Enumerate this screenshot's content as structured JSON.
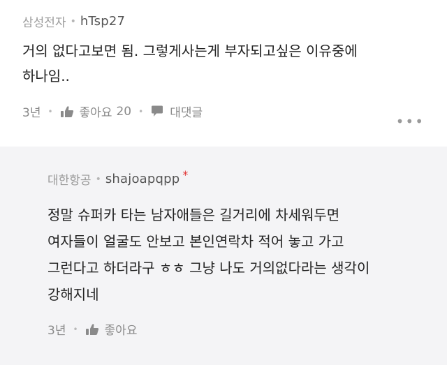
{
  "comments": [
    {
      "company": "삼성전자",
      "nickname": "hTsp27",
      "text_lines": [
        "거의 없다고보면 됨. 그렇게사는게 부자되고싶은 이유중에",
        "하나임.."
      ],
      "time": "3년",
      "like_label": "좋아요",
      "like_count": "20",
      "reply_label": "대댓글",
      "more_label": "•••"
    },
    {
      "company": "대한항공",
      "nickname": "shajoapqpp",
      "star": "*",
      "text_lines": [
        "정말 슈퍼카 타는 남자애들은 길거리에 차세워두면",
        "여자들이 얼굴도 안보고 본인연락차 적어 놓고 가고",
        "그런다고 하더라구 ㅎㅎ 그냥 나도 거의없다라는 생각이",
        "강해지네"
      ],
      "time": "3년",
      "like_label": "좋아요"
    }
  ],
  "separator": "•",
  "icons": {
    "like": "thumbs-up-icon",
    "reply": "speech-bubble-icon"
  },
  "colors": {
    "reply_background": "#f4f4f6",
    "star": "#e03030"
  }
}
